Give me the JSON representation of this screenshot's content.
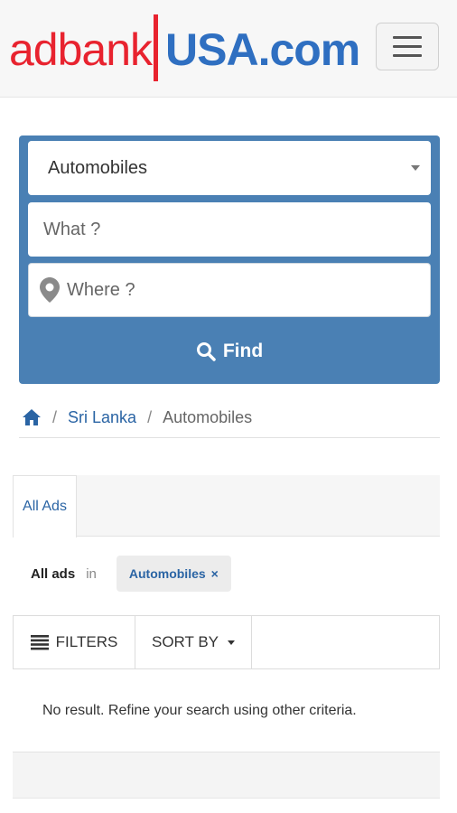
{
  "header": {
    "logo_text_left": "adbank",
    "logo_text_right": "USA.com",
    "colors": {
      "logo_red": "#e8232f",
      "logo_blue": "#2f6fc1"
    },
    "menu_icon": "hamburger-icon"
  },
  "search": {
    "category_value": "Automobiles",
    "what_placeholder": "What ?",
    "where_placeholder": "Where ?",
    "find_label": "Find",
    "panel_color": "#4a80b4"
  },
  "breadcrumb": {
    "home_icon": "home-icon",
    "separator": "/",
    "items": [
      "Sri Lanka",
      "Automobiles"
    ]
  },
  "results": {
    "tabs": [
      {
        "label": "All Ads",
        "active": true
      }
    ],
    "filter_prefix": "All ads",
    "filter_in": "in",
    "chip_label": "Automobiles",
    "chip_close": "×",
    "filters_label": "FILTERS",
    "sort_label": "SORT BY",
    "no_result_text": "No result. Refine your search using other criteria."
  }
}
